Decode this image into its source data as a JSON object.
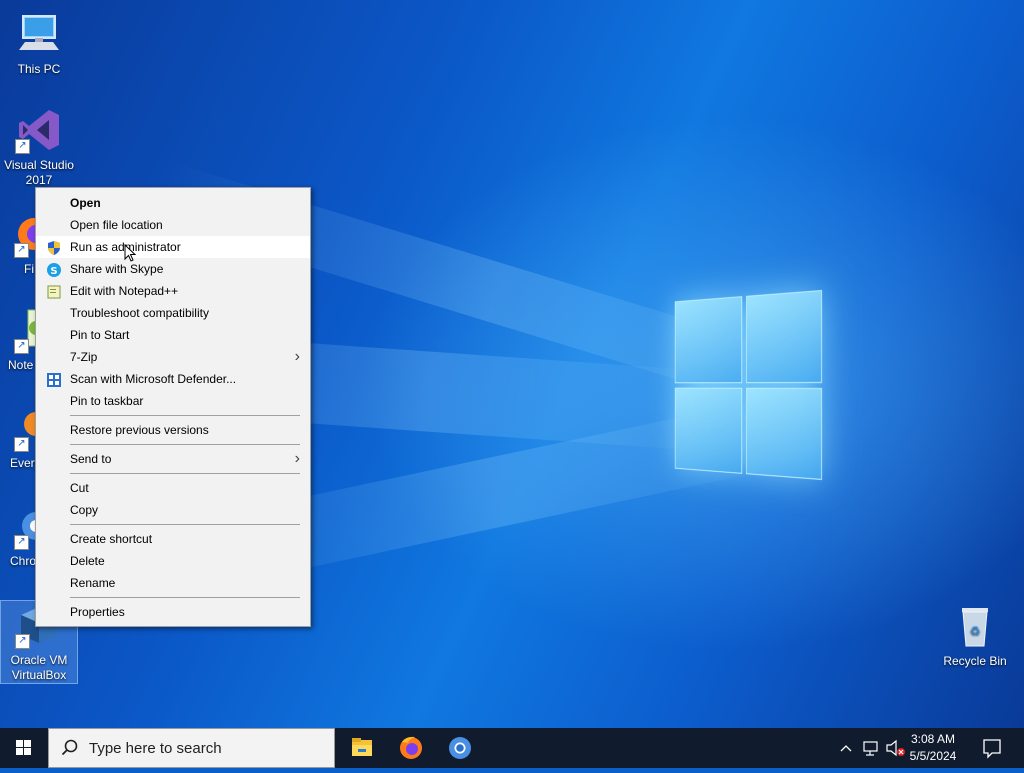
{
  "desktop": {
    "icons": [
      {
        "label": "This PC"
      },
      {
        "label": "Visual Studio 2017"
      },
      {
        "label": "Fi"
      },
      {
        "label": "Note"
      },
      {
        "label": "Every"
      },
      {
        "label": "Chro"
      },
      {
        "label": "Oracle VM VirtualBox"
      },
      {
        "label": "Recycle Bin"
      }
    ]
  },
  "context_menu": {
    "items": [
      {
        "label": "Open",
        "bold": true
      },
      {
        "label": "Open file location"
      },
      {
        "label": "Run as administrator",
        "icon": "uac-shield-icon",
        "hovered": true
      },
      {
        "label": "Share with Skype",
        "icon": "skype-icon"
      },
      {
        "label": "Edit with Notepad++",
        "icon": "notepad-plus-plus-icon"
      },
      {
        "label": "Troubleshoot compatibility"
      },
      {
        "label": "Pin to Start"
      },
      {
        "label": "7-Zip",
        "submenu": true
      },
      {
        "label": "Scan with Microsoft Defender...",
        "icon": "defender-icon"
      },
      {
        "label": "Pin to taskbar"
      },
      {
        "label": "Restore previous versions"
      },
      {
        "label": "Send to",
        "submenu": true
      },
      {
        "label": "Cut"
      },
      {
        "label": "Copy"
      },
      {
        "label": "Create shortcut"
      },
      {
        "label": "Delete"
      },
      {
        "label": "Rename"
      },
      {
        "label": "Properties"
      }
    ]
  },
  "taskbar": {
    "search_placeholder": "Type here to search",
    "apps": [
      "file-explorer-icon",
      "firefox-icon",
      "chrome-icon"
    ],
    "clock": {
      "time": "3:08 AM",
      "date": "5/5/2024"
    }
  },
  "colors": {
    "accent": "#0a5fc8",
    "taskbar": "#101c2e",
    "menu_bg": "#f2f2f2"
  }
}
